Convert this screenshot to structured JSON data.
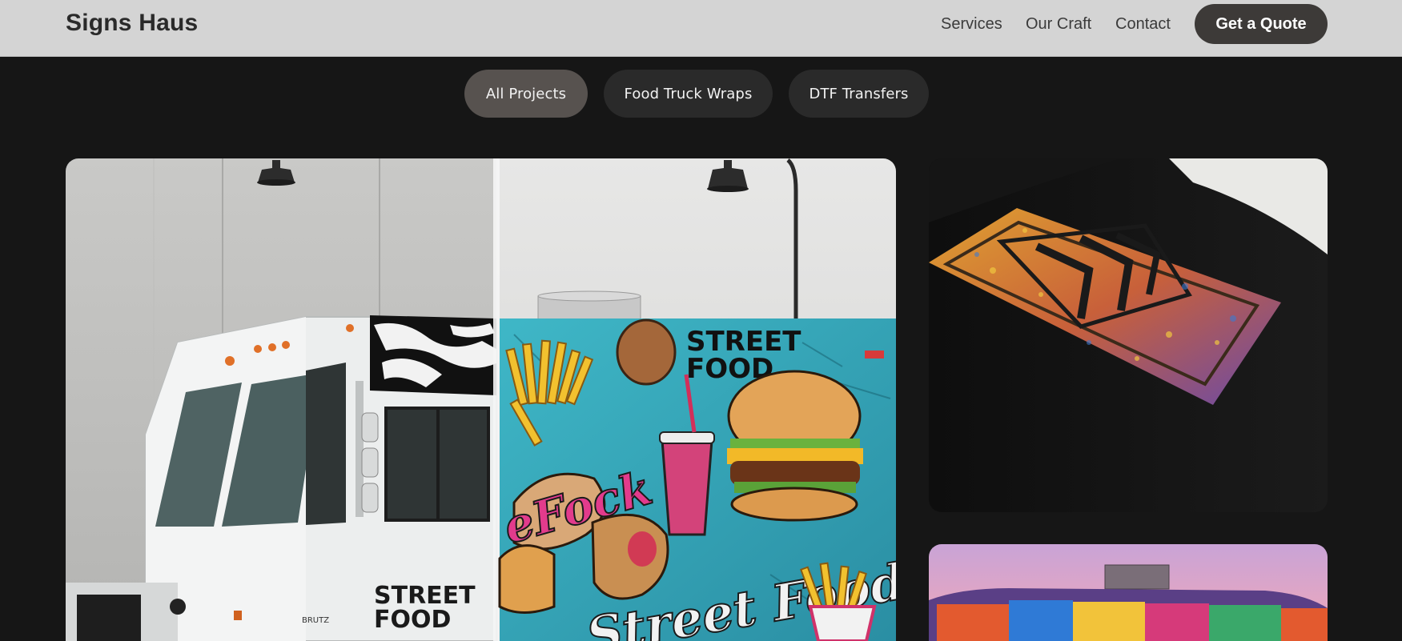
{
  "brand": "Signs Haus",
  "nav": {
    "links": [
      "Services",
      "Our Craft",
      "Contact"
    ],
    "cta": "Get a Quote"
  },
  "filters": [
    {
      "label": "All Projects",
      "active": true
    },
    {
      "label": "Food Truck Wraps",
      "active": false
    },
    {
      "label": "DTF Transfers",
      "active": false
    }
  ],
  "gallery": {
    "main_card": {
      "truck_side_text": "STREET FOOD",
      "wrap_text_top": "STREET FOOD"
    }
  },
  "colors": {
    "nav_bg": "#d4d4d4",
    "page_bg": "#161616",
    "cta_bg": "#3d3a38",
    "filter_active": "#57524f",
    "filter_inactive": "#2a2a2a"
  }
}
